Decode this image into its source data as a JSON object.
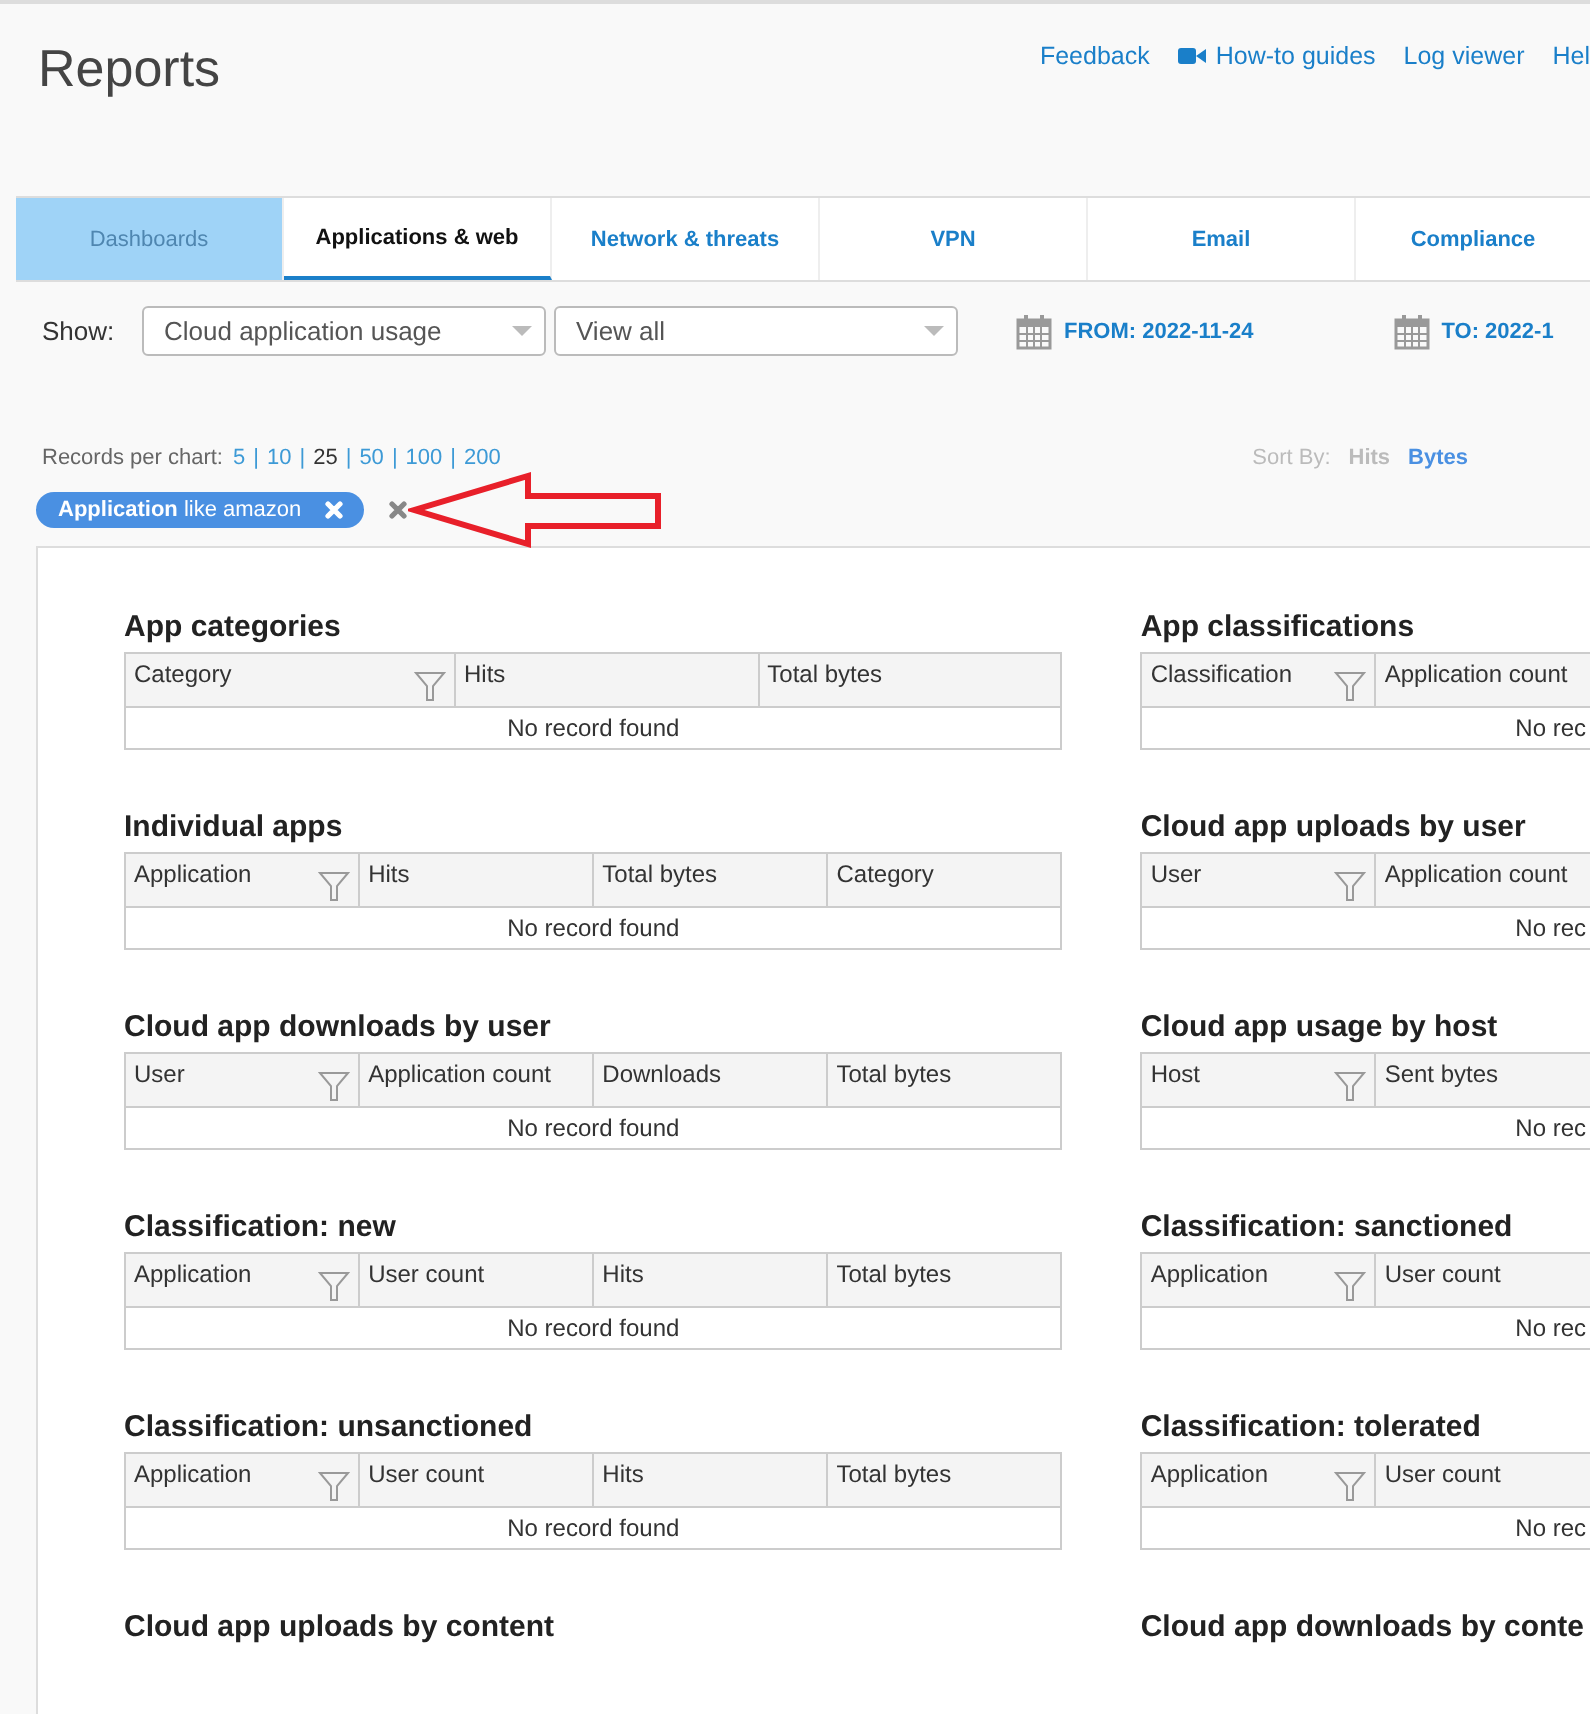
{
  "page_title": "Reports",
  "header_links": [
    {
      "label": "Feedback",
      "kind": "text"
    },
    {
      "label": "How-to guides",
      "kind": "video"
    },
    {
      "label": "Log viewer",
      "kind": "text"
    },
    {
      "label": "Hel",
      "kind": "text"
    }
  ],
  "tabs": [
    {
      "label": "Dashboards",
      "selected": false,
      "disabled": true
    },
    {
      "label": "Applications & web",
      "selected": true,
      "disabled": false
    },
    {
      "label": "Network & threats",
      "selected": false,
      "disabled": false
    },
    {
      "label": "VPN",
      "selected": false,
      "disabled": false
    },
    {
      "label": "Email",
      "selected": false,
      "disabled": false
    },
    {
      "label": "Compliance",
      "selected": false,
      "disabled": false
    }
  ],
  "show": {
    "label": "Show:",
    "report_select": "Cloud application usage",
    "view_select": "View all",
    "from": "FROM: 2022-11-24",
    "to": "TO: 2022-1"
  },
  "records_per_chart": {
    "label": "Records per chart:",
    "separator": "|",
    "options": [
      {
        "label": "5",
        "selected": false
      },
      {
        "label": "10",
        "selected": false
      },
      {
        "label": "25",
        "selected": true
      },
      {
        "label": "50",
        "selected": false
      },
      {
        "label": "100",
        "selected": false
      },
      {
        "label": "200",
        "selected": false
      }
    ]
  },
  "sort_by": {
    "label": "Sort By:",
    "options": [
      {
        "label": "Hits",
        "selected": false
      },
      {
        "label": "Bytes",
        "selected": true
      }
    ]
  },
  "filter_chip": {
    "label": "**Application** like amazon"
  },
  "left_column": [
    {
      "title": "App categories",
      "columns": [
        "Category",
        "Hits",
        "Total bytes"
      ],
      "empty_text": "No record found"
    },
    {
      "title": "Individual apps",
      "columns": [
        "Application",
        "Hits",
        "Total bytes",
        "Category"
      ],
      "empty_text": "No record found"
    },
    {
      "title": "Cloud app downloads by user",
      "columns": [
        "User",
        "Application count",
        "Downloads",
        "Total bytes"
      ],
      "empty_text": "No record found"
    },
    {
      "title": "Classification: new",
      "columns": [
        "Application",
        "User count",
        "Hits",
        "Total bytes"
      ],
      "empty_text": "No record found"
    },
    {
      "title": "Classification: unsanctioned",
      "columns": [
        "Application",
        "User count",
        "Hits",
        "Total bytes"
      ],
      "empty_text": "No record found"
    },
    {
      "title": "Cloud app uploads by content"
    }
  ],
  "right_column": [
    {
      "title": "App classifications",
      "columns": [
        "Classification",
        "Application count"
      ],
      "empty_text": "No rec"
    },
    {
      "title": "Cloud app uploads by user",
      "columns": [
        "User",
        "Application count"
      ],
      "empty_text": "No rec"
    },
    {
      "title": "Cloud app usage by host",
      "columns": [
        "Host",
        "Sent bytes"
      ],
      "empty_text": "No rec"
    },
    {
      "title": "Classification: sanctioned",
      "columns": [
        "Application",
        "User count"
      ],
      "empty_text": "No rec"
    },
    {
      "title": "Classification: tolerated",
      "columns": [
        "Application",
        "User count"
      ],
      "empty_text": "No rec"
    },
    {
      "title": "Cloud app downloads by conte"
    }
  ]
}
